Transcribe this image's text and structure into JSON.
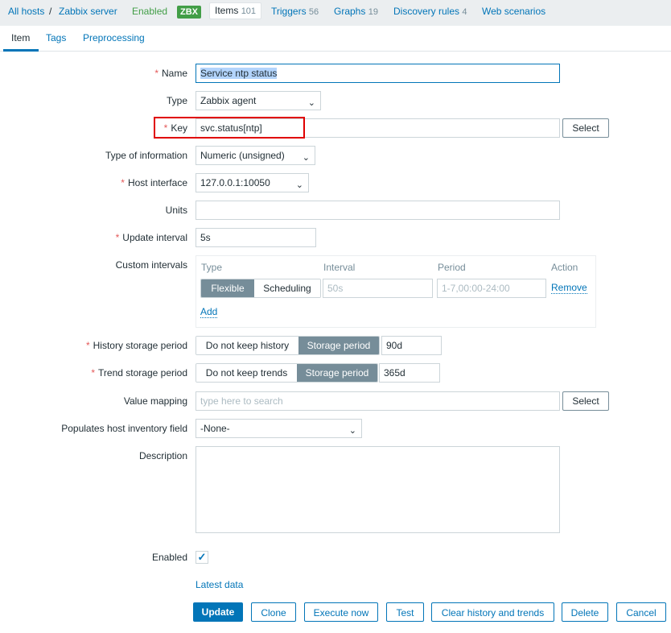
{
  "breadcrumbs": {
    "all_hosts": "All hosts",
    "separator": "/",
    "host": "Zabbix server",
    "status": "Enabled",
    "badge": "ZBX",
    "items_label": "Items",
    "items_count": "101",
    "triggers_label": "Triggers",
    "triggers_count": "56",
    "graphs_label": "Graphs",
    "graphs_count": "19",
    "discovery_label": "Discovery rules",
    "discovery_count": "4",
    "web_label": "Web scenarios"
  },
  "tabs": [
    {
      "label": "Item",
      "active": true
    },
    {
      "label": "Tags",
      "active": false
    },
    {
      "label": "Preprocessing",
      "active": false
    }
  ],
  "form": {
    "required_mark": "*",
    "name": {
      "label": "Name",
      "value": "Service ntp status"
    },
    "type": {
      "label": "Type",
      "value": "Zabbix agent"
    },
    "key": {
      "label": "Key",
      "value": "svc.status[ntp]",
      "button": "Select"
    },
    "type_of_information": {
      "label": "Type of information",
      "value": "Numeric (unsigned)"
    },
    "host_interface": {
      "label": "Host interface",
      "value": "127.0.0.1:10050"
    },
    "units": {
      "label": "Units",
      "value": ""
    },
    "update_interval": {
      "label": "Update interval",
      "value": "5s"
    },
    "custom_intervals": {
      "label": "Custom intervals",
      "headers": {
        "type": "Type",
        "interval": "Interval",
        "period": "Period",
        "action": "Action"
      },
      "row": {
        "flexible": "Flexible",
        "scheduling": "Scheduling",
        "interval_placeholder": "50s",
        "period_placeholder": "1-7,00:00-24:00",
        "remove": "Remove"
      },
      "add": "Add"
    },
    "history": {
      "label": "History storage period",
      "opt_off": "Do not keep history",
      "opt_on": "Storage period",
      "value": "90d"
    },
    "trend": {
      "label": "Trend storage period",
      "opt_off": "Do not keep trends",
      "opt_on": "Storage period",
      "value": "365d"
    },
    "value_mapping": {
      "label": "Value mapping",
      "placeholder": "type here to search",
      "button": "Select"
    },
    "inventory": {
      "label": "Populates host inventory field",
      "value": "-None-"
    },
    "description": {
      "label": "Description",
      "value": ""
    },
    "enabled": {
      "label": "Enabled",
      "checked": true
    },
    "latest_data": "Latest data"
  },
  "buttons": {
    "update": "Update",
    "clone": "Clone",
    "execute_now": "Execute now",
    "test": "Test",
    "clear": "Clear history and trends",
    "delete": "Delete",
    "cancel": "Cancel"
  },
  "colors": {
    "accent": "#0275b8",
    "enabled": "#429e47",
    "required": "#e45959",
    "highlight": "#e00000"
  }
}
